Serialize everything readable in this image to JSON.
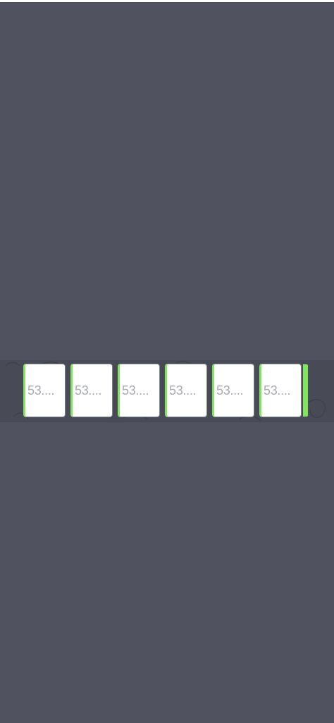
{
  "colors": {
    "background": "#50525f",
    "strip": "#484a56",
    "cell_background": "#ffffff",
    "cell_accent": "#83e45f",
    "cell_text": "#a9abb1"
  },
  "code_input": {
    "cells": [
      {
        "value": "53...."
      },
      {
        "value": "53...."
      },
      {
        "value": "53...."
      },
      {
        "value": "53...."
      },
      {
        "value": "53...."
      },
      {
        "value": "53...."
      }
    ]
  }
}
